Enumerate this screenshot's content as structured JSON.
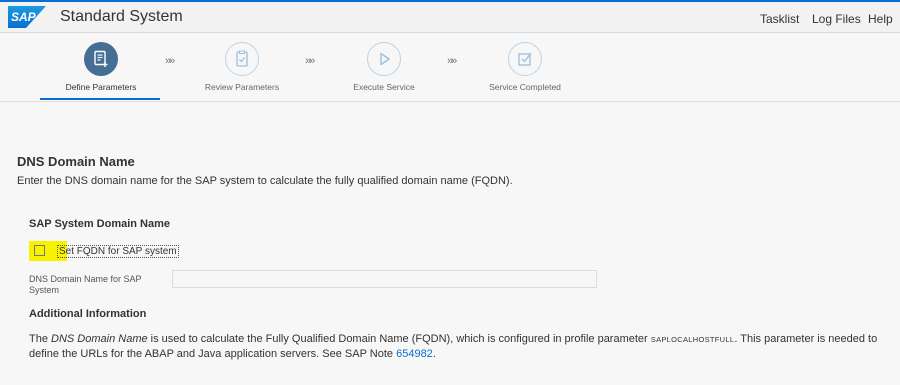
{
  "header": {
    "logo_text": "SAP",
    "title": "Standard System",
    "links": {
      "tasklist": "Tasklist",
      "log_files": "Log Files",
      "help": "Help"
    }
  },
  "roadmap": {
    "separator": "»»",
    "steps": [
      {
        "label": "Define Parameters",
        "icon": "define-parameters-icon",
        "state": "active"
      },
      {
        "label": "Review Parameters",
        "icon": "review-parameters-icon",
        "state": "inactive"
      },
      {
        "label": "Execute Service",
        "icon": "play-icon",
        "state": "inactive"
      },
      {
        "label": "Service Completed",
        "icon": "checkmark-icon",
        "state": "inactive"
      }
    ]
  },
  "content": {
    "section_title": "DNS Domain Name",
    "section_description": "Enter the DNS domain name for the SAP system to calculate the fully qualified domain name (FQDN).",
    "subsection_title": "SAP System Domain Name",
    "checkbox_label": "Set FQDN for SAP system",
    "checkbox_checked": false,
    "dns_field_label": "DNS Domain Name for SAP System",
    "dns_field_value": "",
    "additional_info_title": "Additional Information",
    "info_text": {
      "part1": "The ",
      "emphasis": "DNS Domain Name",
      "part2": " is used to calculate the Fully Qualified Domain Name (FQDN), which is configured in profile parameter ",
      "parameter": "SAPLOCALHOSTFULL",
      "part3": ". This parameter is needed to define the URLs for the ABAP and Java application servers. See SAP Note ",
      "note_number": "654982",
      "part4": "."
    }
  },
  "colors": {
    "accent": "#0a6ed1",
    "active_step": "#456e94",
    "inactive_step_border": "#bcd3e6",
    "highlight": "#f8f200"
  }
}
